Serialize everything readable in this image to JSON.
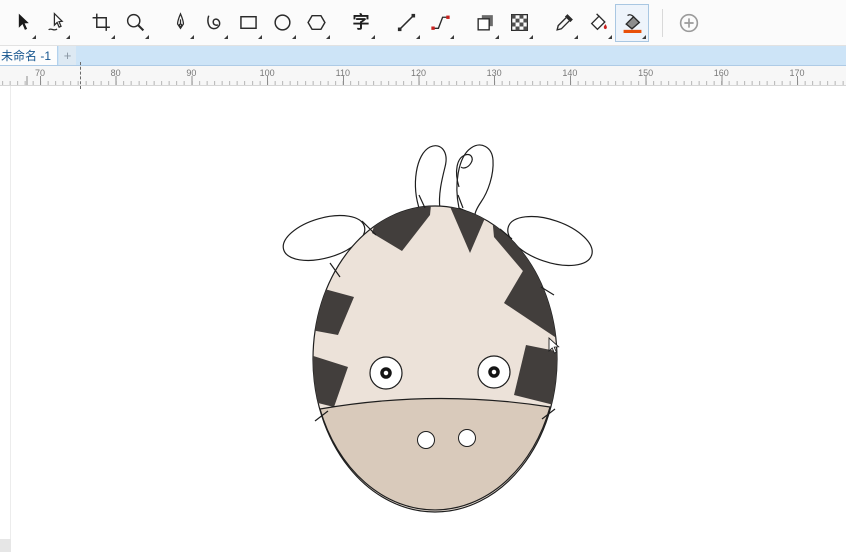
{
  "toolbar": {
    "text_tool_glyph": "字",
    "accent_color": "#e8500a",
    "node_color": "#c9211e",
    "tools": [
      {
        "name": "pick-tool"
      },
      {
        "name": "shape-edit-tool"
      },
      {
        "name": "crop-tool"
      },
      {
        "name": "zoom-tool"
      },
      {
        "name": "pen-tool"
      },
      {
        "name": "freehand-curve-tool"
      },
      {
        "name": "rectangle-tool"
      },
      {
        "name": "ellipse-tool"
      },
      {
        "name": "polygon-tool"
      },
      {
        "name": "text-tool"
      },
      {
        "name": "straight-line-tool"
      },
      {
        "name": "connector-tool"
      },
      {
        "name": "drop-shadow-tool"
      },
      {
        "name": "transparency-tool"
      },
      {
        "name": "eyedropper-tool"
      },
      {
        "name": "smart-fill-tool"
      },
      {
        "name": "interactive-fill-tool"
      },
      {
        "name": "add-tools-button"
      }
    ]
  },
  "tabbar": {
    "active_tab_label": "未命名 -1",
    "new_tab_label": "+"
  },
  "ruler": {
    "unit_labels": [
      "70",
      "80",
      "90",
      "100",
      "110",
      "120",
      "130",
      "140",
      "150",
      "160",
      "170"
    ]
  },
  "drawing": {
    "colors": {
      "outline": "#1e1e1e",
      "head_fill": "#ece2d9",
      "muzzle_fill": "#d9cabb",
      "patch_fill": "#423e3c",
      "white_fill": "#ffffff"
    }
  }
}
